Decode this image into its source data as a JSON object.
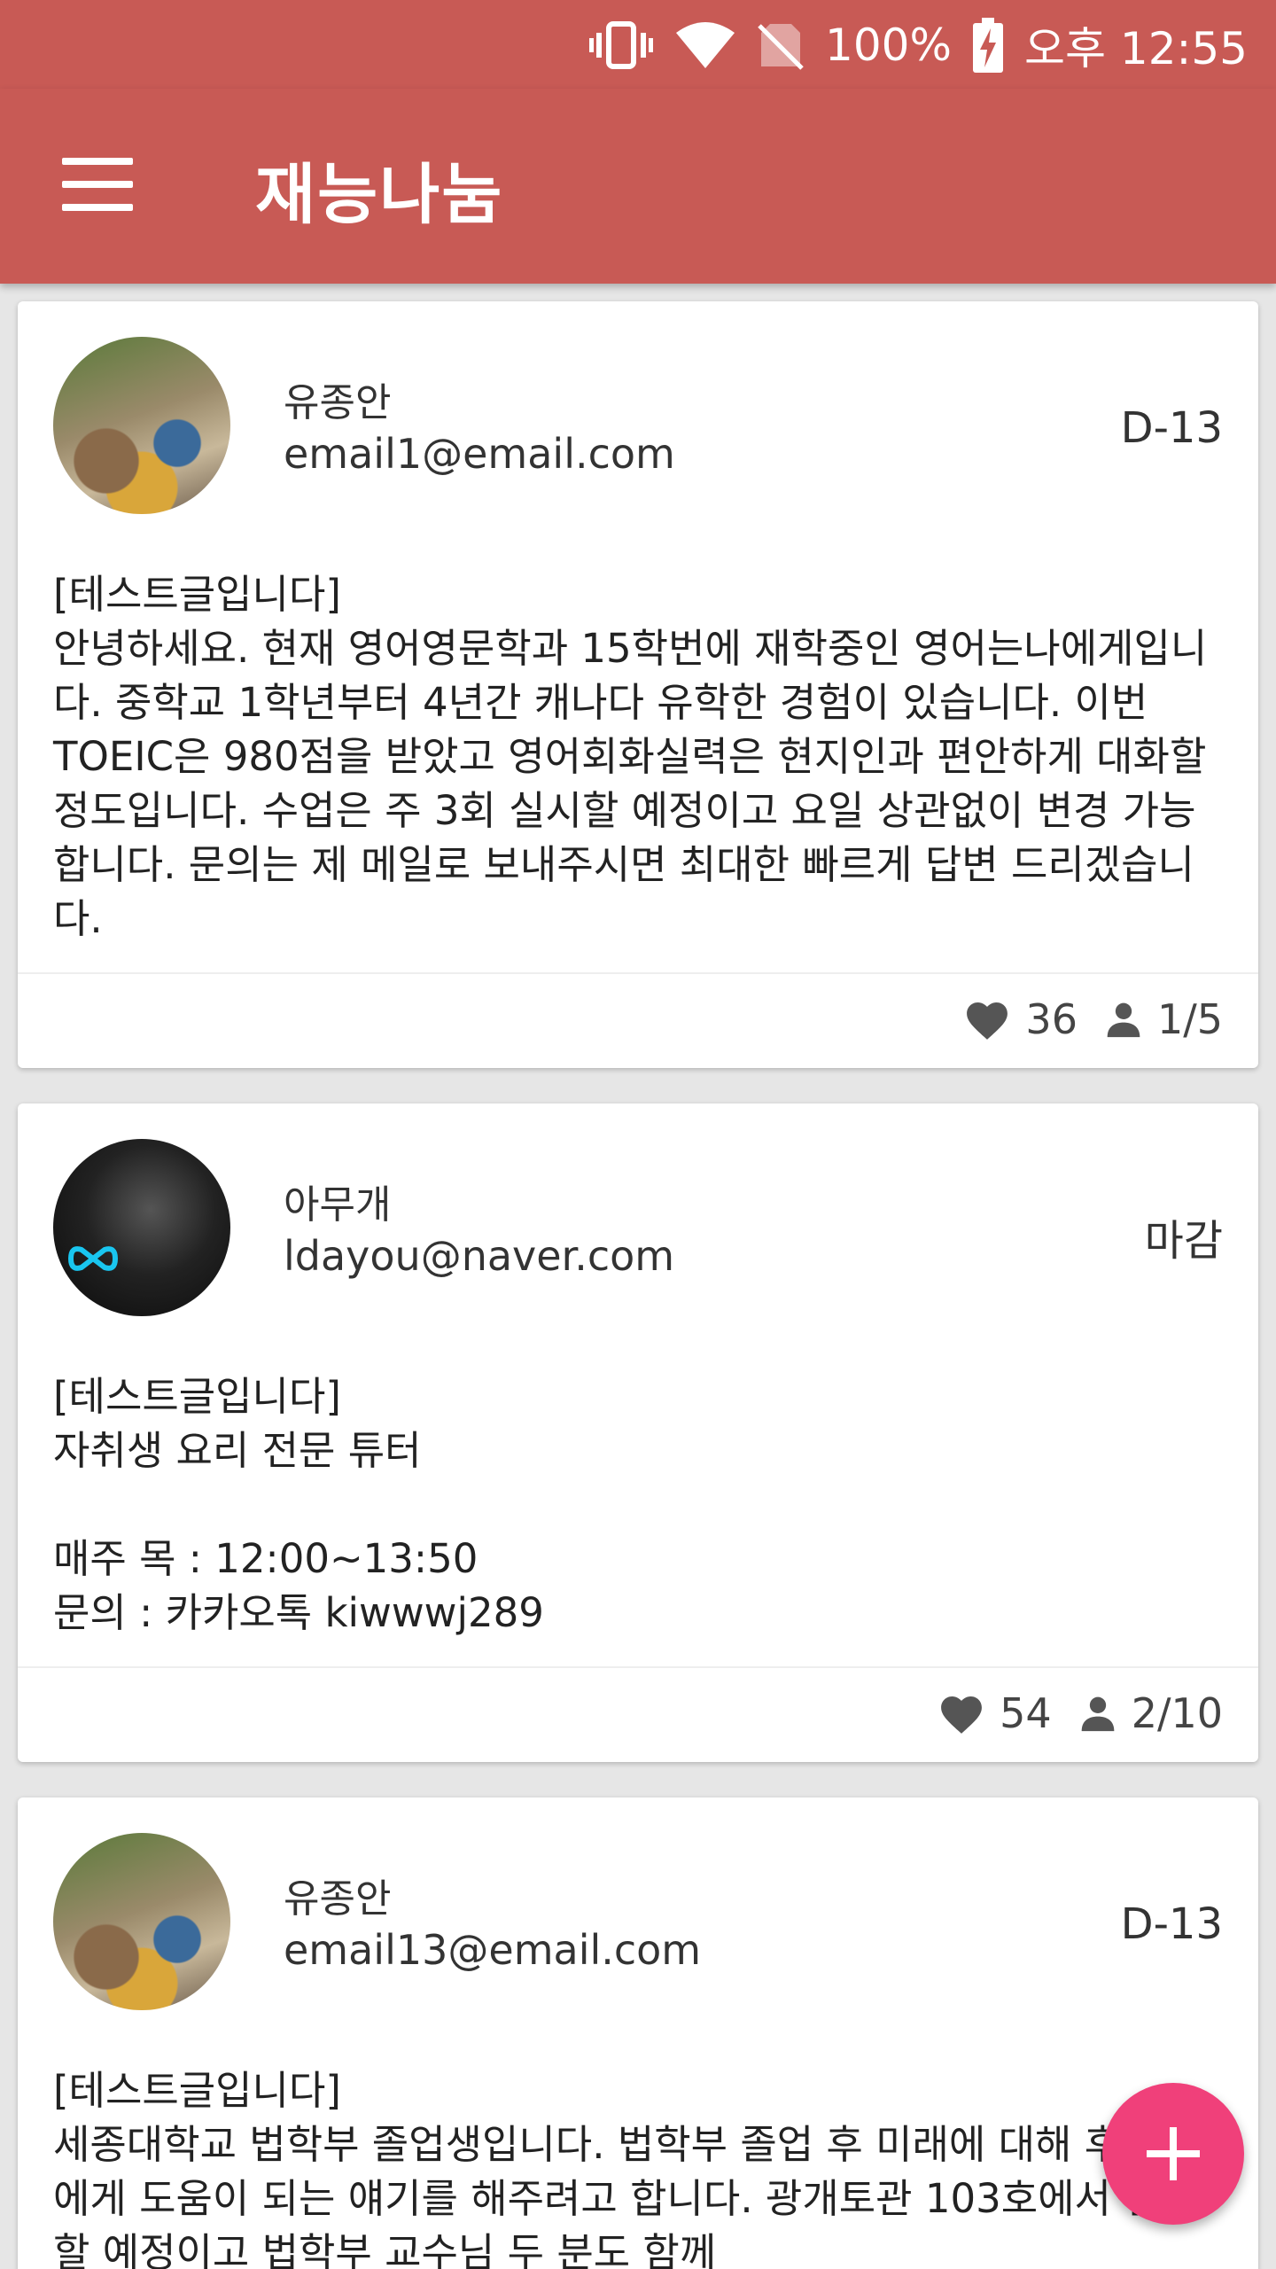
{
  "status_bar": {
    "battery": "100%",
    "time": "오후 12:55",
    "icons": [
      "vibrate-icon",
      "wifi-icon",
      "no-sim-icon",
      "battery-charging-icon"
    ]
  },
  "app_bar": {
    "title": "재능나눔",
    "menu_icon": "hamburger-menu-icon"
  },
  "posts": [
    {
      "author": "유종안",
      "email": "email1@email.com",
      "status": "D-13",
      "text": "[테스트글입니다]\n안녕하세요. 현재 영어영문학과 15학번에 재학중인 영어는나에게입니다. 중학교 1학년부터 4년간 캐나다 유학한 경험이 있습니다. 이번 TOEIC은 980점을 받았고 영어회화실력은 현지인과 편안하게 대화할 정도입니다.  수업은 주 3회 실시할 예정이고 요일 상관없이 변경 가능합니다.  문의는 제 메일로 보내주시면 최대한 빠르게 답변 드리겠습니다.",
      "likes": "36",
      "participants": "1/5"
    },
    {
      "author": "아무개",
      "email": "ldayou@naver.com",
      "status": "마감",
      "text": "[테스트글입니다]\n자취생 요리 전문 튜터\n\n매주 목 : 12:00~13:50\n문의 : 카카오톡 kiwwwj289",
      "likes": "54",
      "participants": "2/10"
    },
    {
      "author": "유종안",
      "email": "email13@email.com",
      "status": "D-13",
      "text": "[테스트글입니다]\n세종대학교 법학부 졸업생입니다. 법학부 졸업 후 미래에 대해 후배분들에게 도움이 되는 얘기를 해주려고 합니다. 광개토관 103호에서 실시할 예정이고 법학부 교수님 두 분도 함께"
    }
  ],
  "fab": {
    "icon": "plus-icon"
  },
  "colors": {
    "primary": "#c85a55",
    "accent": "#f0407a",
    "background": "#e6e6e6"
  }
}
